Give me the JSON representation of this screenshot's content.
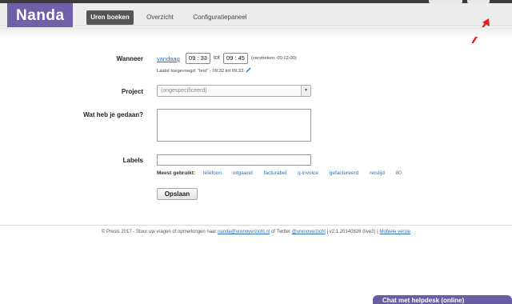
{
  "brand": {
    "logo": "Nanda",
    "accent": "#6f60a8"
  },
  "nav": {
    "items": [
      "Uren boeken",
      "Overzicht",
      "Configuratiepaneel"
    ],
    "active": "Uren boeken"
  },
  "form": {
    "wanneer": {
      "label": "Wanneer",
      "date_link": "vandaag",
      "start": "09 : 33",
      "tot": "tot",
      "end": "09 : 45",
      "elapsed": "(verstreken: 00:12:00)",
      "last_added": "Laatst toegevoegd: \"test\" - 09:32 tot 09:33."
    },
    "project": {
      "label": "Project",
      "value": "(ongespecificeerd)"
    },
    "activity": {
      "label": "Wat heb je gedaan?",
      "value": ""
    },
    "labels": {
      "label": "Labels",
      "value": "",
      "most_used_label": "Meest gebruikt:",
      "tags": [
        "telefoon",
        "uitgaand",
        "facturabel",
        "q-invoice",
        "gefactureerd",
        "reistijd",
        "80"
      ]
    },
    "save_label": "Opslaan"
  },
  "footer": {
    "prefix": "© Presis 2017 - Stuur uw vragen of opmerkingen naar",
    "email": "nanda@urenoverzicht.nl",
    "mid": "of Twitter",
    "twitter": "@urenoverzicht",
    "version": "| v2.1.20140826 (live2) |",
    "mobile": "Mobiele versie"
  },
  "chat": {
    "label": "Chat met helpdesk (online)"
  }
}
